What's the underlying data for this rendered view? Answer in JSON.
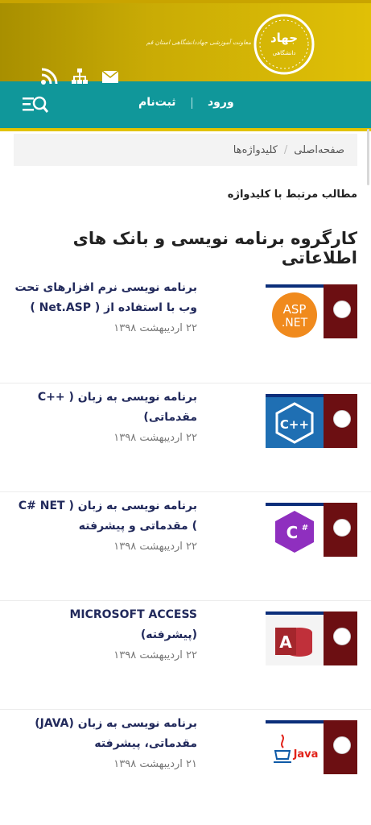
{
  "header": {
    "tagline": "معاونت آموزشی جهاددانشگاهی استان قم",
    "logo_text": "جهاد",
    "logo_subtext": "دانشگاهی",
    "icons": [
      "mail-icon",
      "sitemap-icon",
      "rss-icon"
    ]
  },
  "nav": {
    "login": "ورود",
    "register": "ثبت‌نام",
    "menu_icon": "menu-search-icon"
  },
  "breadcrumb": {
    "home": "صفحه‌اصلی",
    "separator": "/",
    "current": "کلیدواژه‌ها"
  },
  "related_label": "مطالب مرتبط با کلیدواژه",
  "page_title": "کارگروه برنامه نویسی و بانک های اطلاعاتی",
  "articles": [
    {
      "title": "برنامه نویسی نرم افزارهای تحت وب با استفاده از ( Net.ASP )",
      "date": "۲۲ اردیبهشت ۱۳۹۸",
      "thumb_label": "ASP.NET"
    },
    {
      "title": "برنامه نویسی به زبان ( ++C مقدماتی)",
      "date": "۲۲ اردیبهشت ۱۳۹۸",
      "thumb_label": "C++"
    },
    {
      "title": "برنامه نویسی به زبان ( C# NET ) مقدماتی و پیشرفته",
      "date": "۲۲ اردیبهشت ۱۳۹۸",
      "thumb_label": "C#"
    },
    {
      "title": "MICROSOFT ACCESS (پیشرفته)",
      "date": "۲۲ اردیبهشت ۱۳۹۸",
      "thumb_label": "A"
    },
    {
      "title": "برنامه نویسی به زبان (JAVA) مقدماتی، پیشرفته",
      "date": "۲۱ اردیبهشت ۱۳۹۸",
      "thumb_label": "Java"
    }
  ],
  "colors": {
    "header_gold": "#c9ab05",
    "nav_teal": "#10979a",
    "thumb_red": "#8b1d1d",
    "title_navy": "#222a5c"
  }
}
